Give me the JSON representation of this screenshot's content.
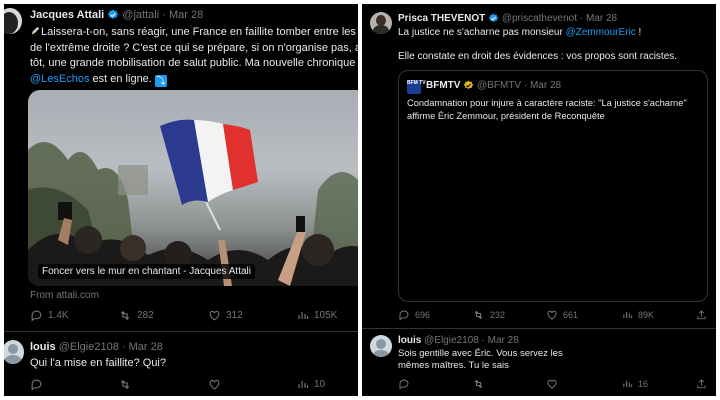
{
  "left": {
    "tweet": {
      "author_name": "Jacques Attali",
      "author_handle": "@jattali",
      "date": "Mar 28",
      "lines": [
        "Laissera-t-on, sans réagir, une France en faillite tomber entre les",
        "de l'extrême droite ? C'est ce qui se prépare, si on n'organise pas, au",
        "tôt, une grande mobilisation de salut public. Ma nouvelle chronique"
      ],
      "line4_mention": "@LesEchos",
      "line4_rest": " est en ligne.",
      "card_caption": "Foncer vers le mur en chantant - Jacques Attali",
      "card_source": "From attali.com",
      "replies": "1.4K",
      "retweets": "282",
      "likes": "312",
      "views": "105K"
    },
    "reply": {
      "author_name": "louis",
      "author_handle": "@Elgie2108",
      "date": "Mar 28",
      "text": "Qui l'a mise en faillite? Qui?",
      "views": "10"
    }
  },
  "right": {
    "tweet": {
      "author_name": "Prisca THEVENOT",
      "author_handle": "@priscathevenot",
      "date": "Mar 28",
      "line1_prefix": "La justice ne s'acharne pas monsieur ",
      "line1_mention": "@ZemmourEric",
      "line1_suffix": " !",
      "line2": "Elle constate en droit des évidences : vos propos sont racistes.",
      "quote": {
        "logo_text": "BFM TV",
        "author_name": "BFMTV",
        "author_handle": "@BFMTV",
        "date": "Mar 28",
        "line1": "Condamnation pour injure à caractère raciste: \"La justice s'acharne\"",
        "line2": "affirme Éric Zemmour, président de Reconquête"
      },
      "replies": "696",
      "retweets": "232",
      "likes": "661",
      "views": "89K"
    },
    "reply": {
      "author_name": "louis",
      "author_handle": "@Elgie2108",
      "date": "Mar 28",
      "line1": "Sois gentille avec Éric. Vous servez les",
      "line2": "mêmes maîtres. Tu le sais",
      "views": "16"
    }
  },
  "colors": {
    "background": "#000000",
    "text": "#e7e9ea",
    "muted": "#71767b",
    "link": "#1d9bf0",
    "verified_blue": "#1d9bf0",
    "verified_gold": "#e2b719",
    "border": "#2f3336"
  }
}
